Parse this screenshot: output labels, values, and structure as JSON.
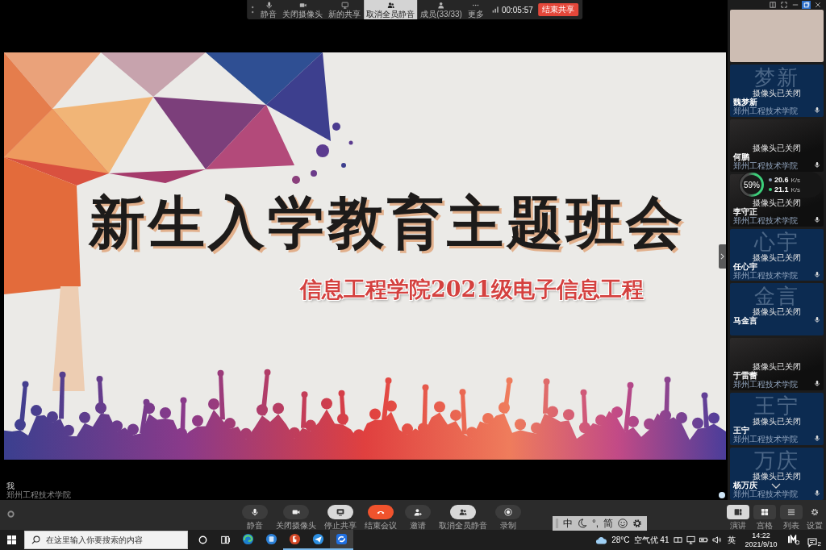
{
  "top_toolbar": {
    "buttons": [
      {
        "kind": "mute",
        "label": "静音",
        "selected": false
      },
      {
        "kind": "camera",
        "label": "关闭摄像头",
        "selected": false
      },
      {
        "kind": "share",
        "label": "新的共享",
        "selected": false
      },
      {
        "kind": "mute-all",
        "label": "取消全员静音",
        "selected": true
      },
      {
        "kind": "members",
        "label": "成员(33/33)",
        "selected": false
      },
      {
        "kind": "more",
        "label": "更多",
        "selected": false
      }
    ],
    "timer": "00:05:57",
    "end_button": "结束共享"
  },
  "slide": {
    "title": "新生入学教育主题班会",
    "subtitle": "信息工程学院2021级电子信息工程"
  },
  "self_view": {
    "name": "我",
    "org": "郑州工程技术学院"
  },
  "participants": [
    {
      "kind": "video"
    },
    {
      "kind": "avatar",
      "avatar_text": "梦新",
      "camera_status": "摄像头已关闭",
      "name": "魏梦新",
      "org": "郑州工程技术学院"
    },
    {
      "kind": "still",
      "camera_status": "摄像头已关闭",
      "name": "何鹏",
      "org": "郑州工程技术学院"
    },
    {
      "kind": "still",
      "camera_status": "摄像头已关闭",
      "name": "李守正",
      "org": "郑州工程技术学院"
    },
    {
      "kind": "avatar",
      "avatar_text": "心宇",
      "camera_status": "摄像头已关闭",
      "name": "任心宇",
      "org": "郑州工程技术学院"
    },
    {
      "kind": "avatar",
      "avatar_text": "金言",
      "camera_status": "摄像头已关闭",
      "name": "马金言"
    },
    {
      "kind": "still",
      "camera_status": "摄像头已关闭",
      "name": "于雷蕾",
      "org": "郑州工程技术学院"
    },
    {
      "kind": "avatar",
      "avatar_text": "王宁",
      "camera_status": "摄像头已关闭",
      "name": "王宁",
      "org": "郑州工程技术学院"
    },
    {
      "kind": "avatar",
      "avatar_text": "万庆",
      "camera_status": "摄像头已关闭",
      "name": "杨万庆",
      "org": "郑州工程技术学院"
    }
  ],
  "network_widget": {
    "percent": "59%",
    "rates": [
      {
        "value": "20.6",
        "unit": "K/s",
        "color": "#8fa0b8"
      },
      {
        "value": "21.1",
        "unit": "K/s",
        "color": "#3ccf7a"
      }
    ]
  },
  "bottom_toolbar": {
    "buttons": [
      {
        "kind": "mute",
        "label": "静音"
      },
      {
        "kind": "camera",
        "label": "关闭摄像头"
      },
      {
        "kind": "stop-share",
        "label": "停止共享"
      },
      {
        "kind": "end",
        "label": "结束会议"
      },
      {
        "kind": "invite",
        "label": "邀请"
      },
      {
        "kind": "mute-all",
        "label": "取消全员静音"
      },
      {
        "kind": "record",
        "label": "录制"
      }
    ],
    "views": [
      {
        "kind": "speaker",
        "label": "演讲",
        "selected": true
      },
      {
        "kind": "grid",
        "label": "宫格",
        "selected": false
      },
      {
        "kind": "list",
        "label": "列表",
        "selected": false
      }
    ],
    "settings_label": "设置"
  },
  "ime_bar": {
    "mode": "中",
    "punctuation": "°,",
    "script": "简"
  },
  "taskbar": {
    "search_placeholder": "在这里输入你要搜索的内容",
    "apps": [
      {
        "kind": "browser",
        "running": false,
        "selected": false
      },
      {
        "kind": "app",
        "running": false,
        "selected": false
      },
      {
        "kind": "slides",
        "running": true,
        "selected": false
      },
      {
        "kind": "messenger",
        "running": true,
        "selected": false
      },
      {
        "kind": "meeting",
        "running": true,
        "selected": true
      }
    ],
    "temperature": "28°C",
    "air_quality": "空气优 41",
    "input_language": "英",
    "time": "14:22",
    "date": "2021/9/10",
    "notification_count": "2"
  }
}
